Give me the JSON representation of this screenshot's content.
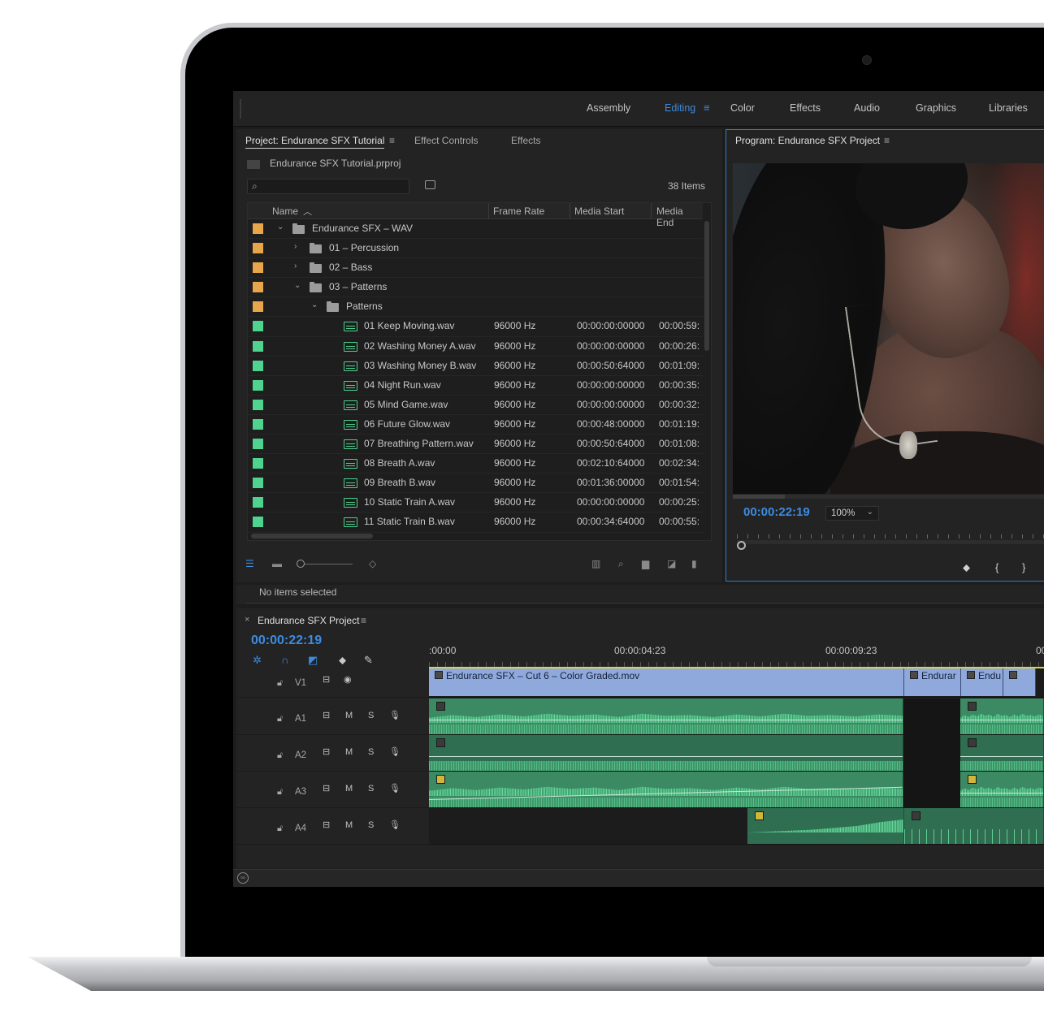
{
  "workspaces": {
    "tabs": [
      "Assembly",
      "Editing",
      "Color",
      "Effects",
      "Audio",
      "Graphics",
      "Libraries"
    ],
    "active": "Editing",
    "menu_icon": "hamburger-icon"
  },
  "project_panel": {
    "tabs": [
      "Project: Endurance SFX Tutorial",
      "Effect Controls",
      "Effects"
    ],
    "file_name": "Endurance SFX Tutorial.prproj",
    "search_placeholder": "",
    "items_count": "38 Items",
    "columns": [
      "Name",
      "Frame Rate",
      "Media Start",
      "Media End"
    ],
    "rows": [
      {
        "name": "Endurance SFX – WAV",
        "type": "folder",
        "level": 0,
        "expanded": true,
        "color": "#e8a64a"
      },
      {
        "name": "01 – Percussion",
        "type": "folder",
        "level": 1,
        "expanded": false,
        "color": "#e8a64a"
      },
      {
        "name": "02 – Bass",
        "type": "folder",
        "level": 1,
        "expanded": false,
        "color": "#e8a64a"
      },
      {
        "name": "03 – Patterns",
        "type": "folder",
        "level": 1,
        "expanded": true,
        "color": "#e8a64a"
      },
      {
        "name": "Patterns",
        "type": "folder",
        "level": 2,
        "expanded": true,
        "color": "#e8a64a"
      },
      {
        "name": "01 Keep Moving.wav",
        "type": "audio",
        "frame_rate": "96000 Hz",
        "media_start": "00:00:00:00000",
        "media_end": "00:00:59:",
        "color": "#4fd48f"
      },
      {
        "name": "02 Washing Money A.wav",
        "type": "audio",
        "frame_rate": "96000 Hz",
        "media_start": "00:00:00:00000",
        "media_end": "00:00:26:",
        "color": "#4fd48f"
      },
      {
        "name": "03 Washing Money B.wav",
        "type": "audio",
        "frame_rate": "96000 Hz",
        "media_start": "00:00:50:64000",
        "media_end": "00:01:09:",
        "color": "#4fd48f"
      },
      {
        "name": "04 Night Run.wav",
        "type": "audio",
        "frame_rate": "96000 Hz",
        "media_start": "00:00:00:00000",
        "media_end": "00:00:35:",
        "color": "#4fd48f"
      },
      {
        "name": "05 Mind Game.wav",
        "type": "audio",
        "frame_rate": "96000 Hz",
        "media_start": "00:00:00:00000",
        "media_end": "00:00:32:",
        "color": "#4fd48f"
      },
      {
        "name": "06 Future Glow.wav",
        "type": "audio",
        "frame_rate": "96000 Hz",
        "media_start": "00:00:48:00000",
        "media_end": "00:01:19:",
        "color": "#4fd48f"
      },
      {
        "name": "07 Breathing Pattern.wav",
        "type": "audio",
        "frame_rate": "96000 Hz",
        "media_start": "00:00:50:64000",
        "media_end": "00:01:08:",
        "color": "#4fd48f"
      },
      {
        "name": "08 Breath A.wav",
        "type": "audio",
        "frame_rate": "96000 Hz",
        "media_start": "00:02:10:64000",
        "media_end": "00:02:34:",
        "color": "#4fd48f"
      },
      {
        "name": "09 Breath B.wav",
        "type": "audio",
        "frame_rate": "96000 Hz",
        "media_start": "00:01:36:00000",
        "media_end": "00:01:54:",
        "color": "#4fd48f"
      },
      {
        "name": "10 Static Train A.wav",
        "type": "audio",
        "frame_rate": "96000 Hz",
        "media_start": "00:00:00:00000",
        "media_end": "00:00:25:",
        "color": "#4fd48f"
      },
      {
        "name": "11 Static Train B.wav",
        "type": "audio",
        "frame_rate": "96000 Hz",
        "media_start": "00:00:34:64000",
        "media_end": "00:00:55:",
        "color": "#4fd48f"
      }
    ],
    "status_text": "No items selected"
  },
  "program_monitor": {
    "title": "Program: Endurance SFX Project",
    "timecode": "00:00:22:19",
    "zoom": "100%"
  },
  "timeline": {
    "title": "Endurance SFX Project",
    "timecode": "00:00:22:19",
    "ruler_labels": [
      ":00:00",
      "00:00:04:23",
      "00:00:09:23",
      "00"
    ],
    "tracks": [
      {
        "name": "V1",
        "kind": "video"
      },
      {
        "name": "A1",
        "kind": "audio",
        "m": "M",
        "s": "S"
      },
      {
        "name": "A2",
        "kind": "audio",
        "m": "M",
        "s": "S"
      },
      {
        "name": "A3",
        "kind": "audio",
        "m": "M",
        "s": "S"
      },
      {
        "name": "A4",
        "kind": "audio",
        "m": "M",
        "s": "S"
      }
    ],
    "video_clips": [
      "Endurance SFX – Cut 6 – Color Graded.mov",
      "Endurar",
      "Endu"
    ],
    "colors": {
      "accent": "#3d8be0",
      "video_clip": "#8fa9dd",
      "audio_clip": "#3b8a63",
      "playhead_bar": "#e0d23a"
    }
  }
}
